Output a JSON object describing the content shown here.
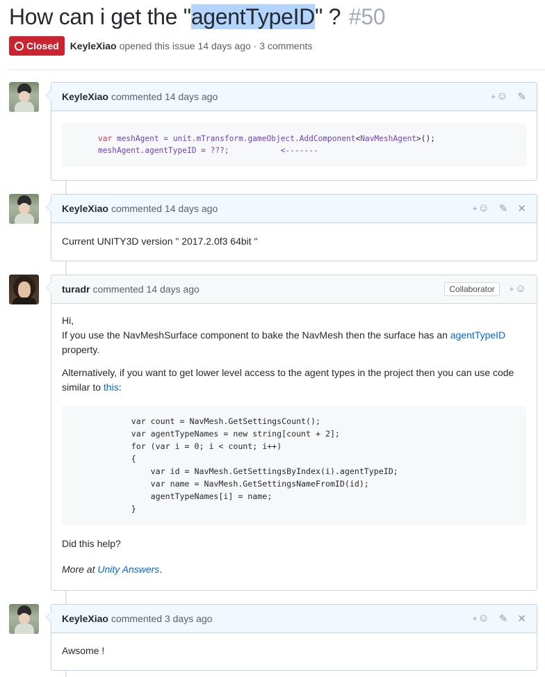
{
  "issue": {
    "title_before": "How can i get the \"",
    "title_highlight": "agentTypeID",
    "title_after": "\" ?",
    "number": "#50",
    "state": "Closed",
    "author": "KeyleXiao",
    "opened_text": "opened this issue 14 days ago · 3 comments"
  },
  "comments": [
    {
      "author": "KeyleXiao",
      "meta": "commented 14 days ago",
      "code_line1_kw": "var",
      "code_line1_rest_a": " meshAgent = unit.mTransform.gameObject.",
      "code_line1_fn": "AddComponent",
      "code_line1_rest_b": "<",
      "code_line1_type": "NavMeshAgent",
      "code_line1_rest_c": ">();",
      "code_line2": "meshAgent.agentTypeID = ???;           <-------"
    },
    {
      "author": "KeyleXiao",
      "meta": "commented 14 days ago",
      "body": "Current UNITY3D version \" 2017.2.0f3 64bit \""
    },
    {
      "author": "turadr",
      "meta": "commented 14 days ago",
      "badge": "Collaborator",
      "greeting": "Hi,",
      "p1_before": "If you use the NavMeshSurface component to bake the NavMesh then the surface has an ",
      "p1_link": "agentTypeID",
      "p1_after": "property.",
      "p2_before": "Alternatively, if you want to get lower level access to the agent types in the project then you can use code similar to ",
      "p2_link": "this",
      "p2_after": ":",
      "code": "            var count = NavMesh.GetSettingsCount();\n            var agentTypeNames = new string[count + 2];\n            for (var i = 0; i < count; i++)\n            {\n                var id = NavMesh.GetSettingsByIndex(i).agentTypeID;\n                var name = NavMesh.GetSettingsNameFromID(id);\n                agentTypeNames[i] = name;\n            }",
      "question": "Did this help?",
      "more_before": "More at ",
      "more_link": "Unity Answers",
      "more_after": "."
    },
    {
      "author": "KeyleXiao",
      "meta": "commented 3 days ago",
      "body": "Awsome !"
    }
  ],
  "icons": {
    "react_plus": "+",
    "react_smile": "☺",
    "edit": "✎",
    "delete": "✕"
  },
  "colors": {
    "closed_state": "#cb2431",
    "link": "#0366d6",
    "highlight": "#b3d4fc",
    "owner_header": "#f1f8ff"
  }
}
